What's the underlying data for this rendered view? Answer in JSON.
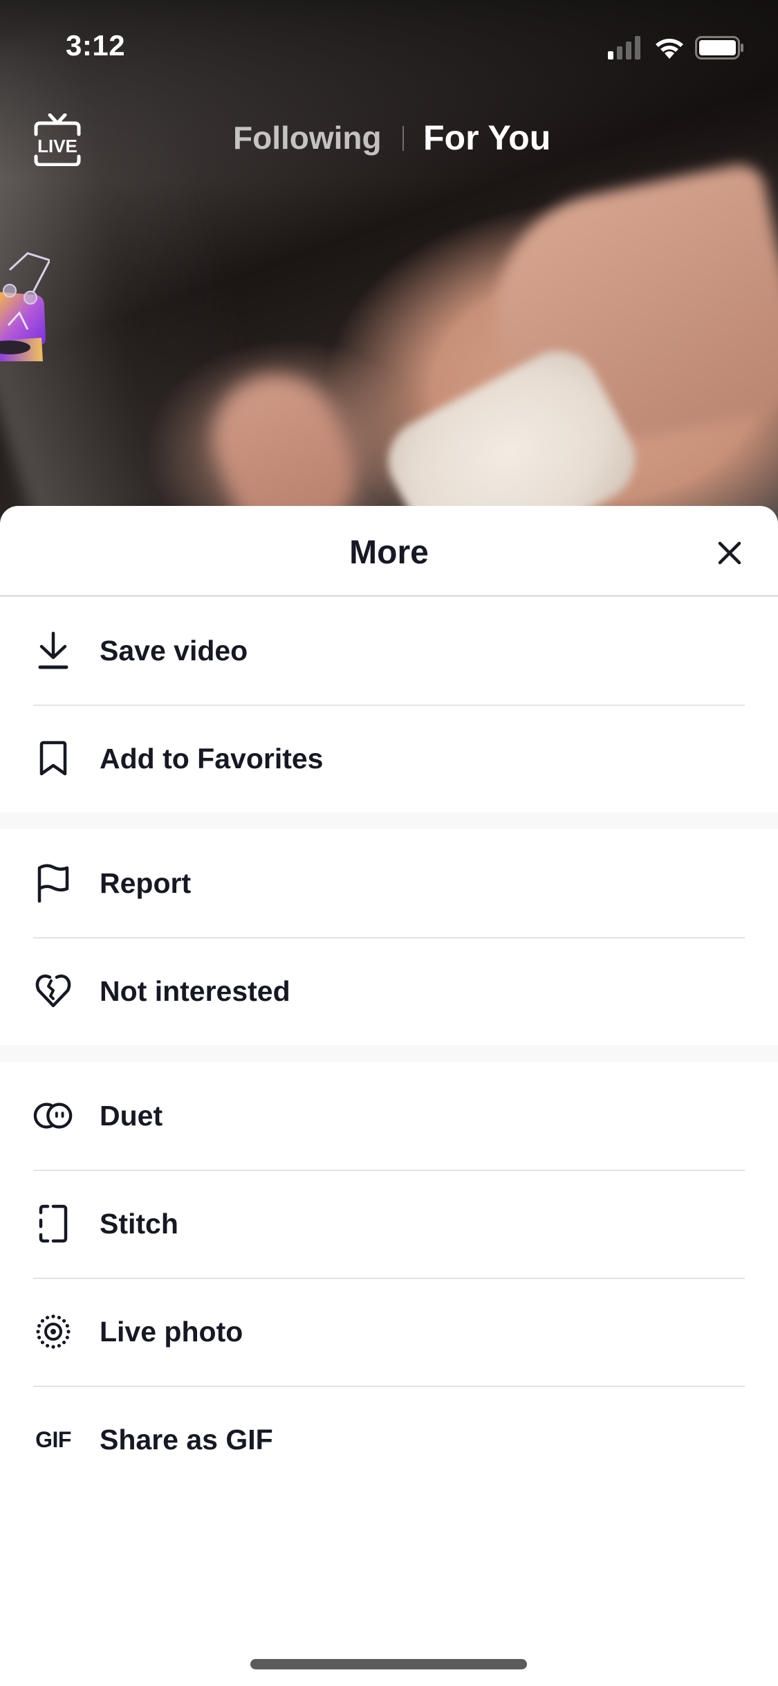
{
  "status_bar": {
    "time": "3:12",
    "signal_icon": "cellular-signal-icon",
    "wifi_icon": "wifi-icon",
    "battery_icon": "battery-icon"
  },
  "top_nav": {
    "live_label": "LIVE",
    "live_icon": "live-tv-icon",
    "tabs": [
      {
        "label": "Following",
        "active": false
      },
      {
        "label": "For You",
        "active": true
      }
    ]
  },
  "video": {
    "sticker_icon": "record-player-music-sticker-icon"
  },
  "sheet": {
    "title": "More",
    "close_icon": "close-icon",
    "groups": [
      {
        "items": [
          {
            "label": "Save video",
            "icon": "download-icon"
          },
          {
            "label": "Add to Favorites",
            "icon": "bookmark-icon"
          }
        ]
      },
      {
        "items": [
          {
            "label": "Report",
            "icon": "flag-icon"
          },
          {
            "label": "Not interested",
            "icon": "broken-heart-icon"
          }
        ]
      },
      {
        "items": [
          {
            "label": "Duet",
            "icon": "duet-icon"
          },
          {
            "label": "Stitch",
            "icon": "stitch-icon"
          },
          {
            "label": "Live photo",
            "icon": "live-photo-icon"
          },
          {
            "label": "Share as GIF",
            "icon": "gif-icon",
            "icon_text": "GIF"
          }
        ]
      }
    ]
  },
  "colors": {
    "text_primary": "#161823",
    "divider": "#e3e3e4",
    "group_gap": "#f8f8f8",
    "home_indicator": "#5b5b5b"
  }
}
